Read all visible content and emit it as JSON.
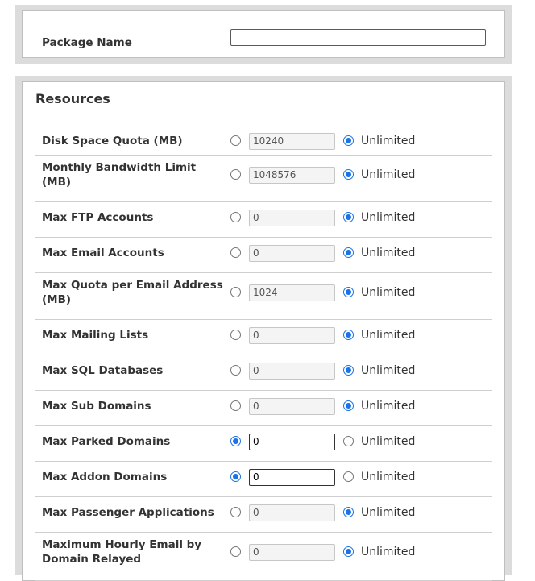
{
  "package": {
    "label": "Package Name",
    "value": ""
  },
  "resources": {
    "title": "Resources",
    "unlimited_label": "Unlimited",
    "rows": [
      {
        "label": "Disk Space Quota (MB)",
        "value": "10240",
        "unlimited": true
      },
      {
        "label": "Monthly Bandwidth Limit (MB)",
        "value": "1048576",
        "unlimited": true
      },
      {
        "label": "Max FTP Accounts",
        "value": "0",
        "unlimited": true
      },
      {
        "label": "Max Email Accounts",
        "value": "0",
        "unlimited": true
      },
      {
        "label": "Max Quota per Email Address (MB)",
        "value": "1024",
        "unlimited": true
      },
      {
        "label": "Max Mailing Lists",
        "value": "0",
        "unlimited": true
      },
      {
        "label": "Max SQL Databases",
        "value": "0",
        "unlimited": true
      },
      {
        "label": "Max Sub Domains",
        "value": "0",
        "unlimited": true
      },
      {
        "label": "Max Parked Domains",
        "value": "0",
        "unlimited": false
      },
      {
        "label": "Max Addon Domains",
        "value": "0",
        "unlimited": false
      },
      {
        "label": "Max Passenger Applications",
        "value": "0",
        "unlimited": true
      },
      {
        "label": "Maximum Hourly Email by Domain Relayed",
        "value": "0",
        "unlimited": true
      }
    ]
  }
}
